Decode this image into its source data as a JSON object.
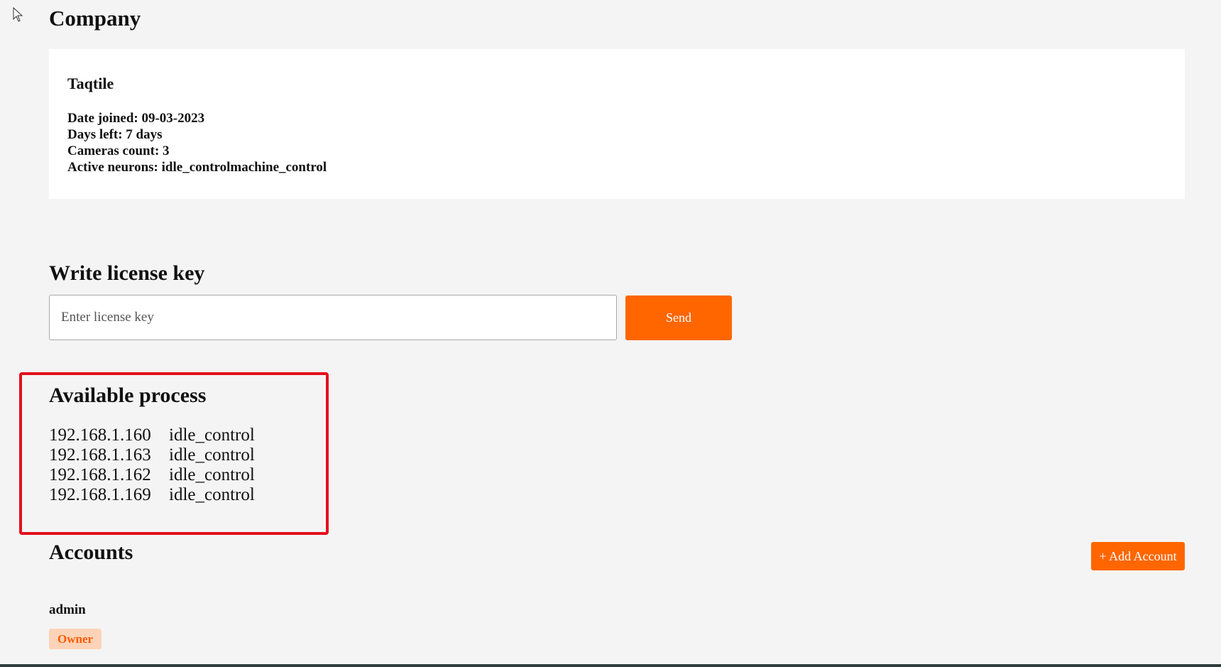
{
  "company": {
    "heading": "Company",
    "name": "Taqtile",
    "details": [
      "Date joined: 09-03-2023",
      "Days left: 7 days",
      "Cameras count: 3",
      "Active neurons: idle_controlmachine_control"
    ]
  },
  "license": {
    "heading": "Write license key",
    "placeholder": "Enter license key",
    "value": "",
    "send_label": "Send"
  },
  "processes": {
    "heading": "Available process",
    "items": [
      {
        "ip": "192.168.1.160",
        "name": "idle_control"
      },
      {
        "ip": "192.168.1.163",
        "name": "idle_control"
      },
      {
        "ip": "192.168.1.162",
        "name": "idle_control"
      },
      {
        "ip": "192.168.1.169",
        "name": "idle_control"
      }
    ]
  },
  "accounts": {
    "heading": "Accounts",
    "add_label": "+ Add Account",
    "items": [
      {
        "username": "admin",
        "role": "Owner"
      }
    ]
  },
  "colors": {
    "accent": "#ff6600",
    "highlight_border": "#e3101b",
    "badge_bg": "#ffd3b8",
    "badge_text": "#ff5a00",
    "page_bg": "#f4f4f4"
  },
  "icons": {
    "cursor": "mouse-pointer-icon"
  }
}
